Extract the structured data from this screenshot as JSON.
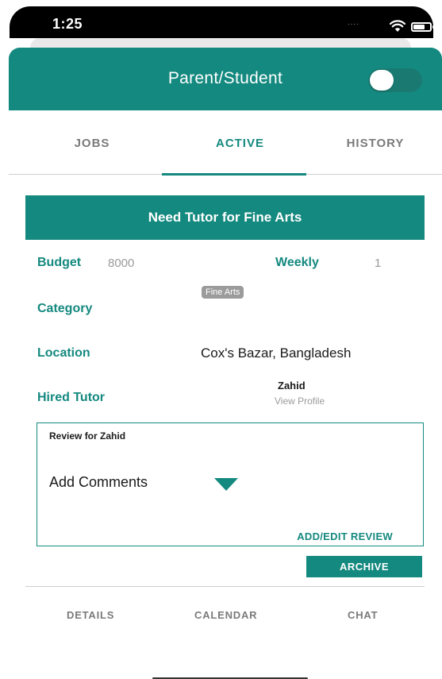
{
  "status_bar": {
    "time": "1:25",
    "signal": "....",
    "wifi_icon": "wifi-icon",
    "battery_icon": "battery-icon"
  },
  "header": {
    "title": "Parent/Student",
    "toggle_on": true
  },
  "tabs": [
    {
      "label": "JOBS",
      "active": false
    },
    {
      "label": "ACTIVE",
      "active": true
    },
    {
      "label": "HISTORY",
      "active": false
    }
  ],
  "job": {
    "title": "Need Tutor for Fine Arts",
    "budget_label": "Budget",
    "budget_value": "8000",
    "frequency_label": "Weekly",
    "frequency_value": "1",
    "category_label": "Category",
    "category_chip": "Fine Arts",
    "location_label": "Location",
    "location_value": "Cox's Bazar, Bangladesh",
    "hired_tutor_label": "Hired Tutor",
    "tutor_name": "Zahid",
    "view_profile": "View Profile"
  },
  "review": {
    "title": "Review for Zahid",
    "comments_placeholder": "Add Comments",
    "add_edit_label": "ADD/EDIT REVIEW"
  },
  "archive_label": "ARCHIVE",
  "bottom_tabs": [
    "DETAILS",
    "CALENDAR",
    "CHAT"
  ],
  "colors": {
    "accent": "#14897f",
    "muted": "#7a7a7a",
    "chip": "#9b9b9b"
  }
}
